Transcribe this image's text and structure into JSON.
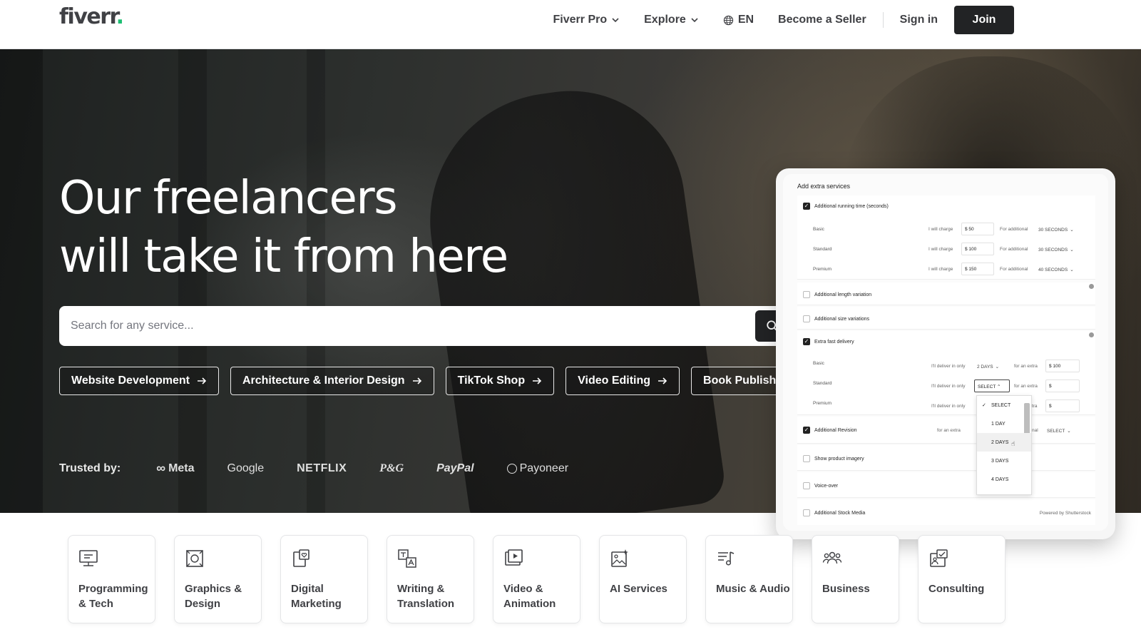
{
  "header": {
    "logo_text": "fiverr",
    "logo_dot": ".",
    "nav": {
      "pro": "Fiverr Pro",
      "explore": "Explore",
      "language": "EN",
      "become_seller": "Become a Seller",
      "sign_in": "Sign in",
      "join": "Join"
    }
  },
  "hero": {
    "title_line1": "Our freelancers",
    "title_line2": "will take it from here",
    "search_placeholder": "Search for any service...",
    "chips": [
      "Website Development",
      "Architecture & Interior Design",
      "TikTok Shop",
      "Video Editing",
      "Book Publishing"
    ],
    "trusted_label": "Trusted by:",
    "brands": [
      "Meta",
      "Google",
      "NETFLIX",
      "P&G",
      "PayPal",
      "Payoneer"
    ]
  },
  "panel": {
    "title": "Add extra services",
    "running_time": {
      "label": "Additional running time (seconds)",
      "rows": [
        {
          "tier": "Basic",
          "charge_label": "I will charge",
          "charge": "$ 50",
          "for_label": "For additional",
          "select": "30 SECONDS"
        },
        {
          "tier": "Standard",
          "charge_label": "I will charge",
          "charge": "$ 100",
          "for_label": "For additional",
          "select": "30 SECONDS"
        },
        {
          "tier": "Premium",
          "charge_label": "I will charge",
          "charge": "$ 150",
          "for_label": "For additional",
          "select": "40 SECONDS"
        }
      ]
    },
    "length_variation": "Additional length variation",
    "size_variations": "Additional size variations",
    "fast_delivery": {
      "label": "Extra fast delivery",
      "rows": [
        {
          "tier": "Basic",
          "deliver_label": "I'll deliver in only",
          "select": "2 DAYS",
          "extra_label": "for an extra",
          "price": "$ 100"
        },
        {
          "tier": "Standard",
          "deliver_label": "I'll deliver in only",
          "select": "SELECT",
          "extra_label": "for an extra",
          "price": "$"
        },
        {
          "tier": "Premium",
          "deliver_label": "I'll deliver in only",
          "select": "",
          "extra_label": "extra",
          "price": "$"
        }
      ]
    },
    "revision": {
      "label": "Additional Revision",
      "extra_label": "for an extra",
      "additional_label": "ional",
      "select": "SELECT"
    },
    "product_imagery": "Show product imagery",
    "voice_over": "Voice-over",
    "stock_media": "Additional Stock Media",
    "powered_by": "Powered by Shutterstock",
    "dropdown_options": [
      "SELECT",
      "1 DAY",
      "2 DAYS",
      "3 DAYS",
      "4 DAYS"
    ],
    "dropdown_selected": "SELECT",
    "dropdown_hovered": "2 DAYS"
  },
  "categories": [
    {
      "label": "Programming\n& Tech",
      "icon": "monitor-icon"
    },
    {
      "label": "Graphics &\nDesign",
      "icon": "design-icon"
    },
    {
      "label": "Digital\nMarketing",
      "icon": "marketing-icon"
    },
    {
      "label": "Writing &\nTranslation",
      "icon": "translation-icon"
    },
    {
      "label": "Video &\nAnimation",
      "icon": "video-icon"
    },
    {
      "label": "AI Services",
      "icon": "ai-image-icon"
    },
    {
      "label": "Music & Audio",
      "icon": "music-icon"
    },
    {
      "label": "Business",
      "icon": "people-icon"
    },
    {
      "label": "Consulting",
      "icon": "consulting-icon"
    }
  ],
  "colors": {
    "brand_green": "#1dbf73",
    "dark": "#222325",
    "text": "#404145"
  }
}
